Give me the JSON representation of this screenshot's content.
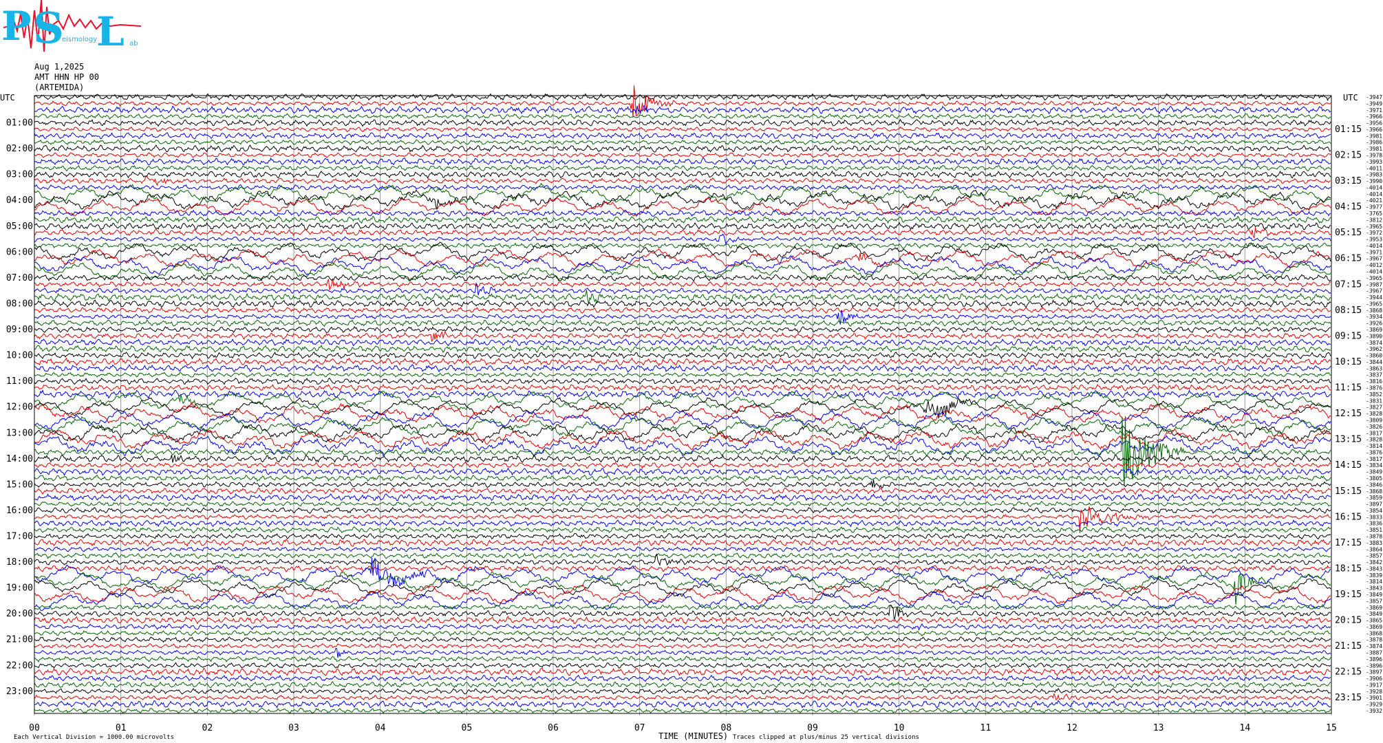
{
  "logo": {
    "letters": [
      "P",
      "S",
      "L"
    ],
    "sub_texts": [
      "eismology",
      "ab"
    ],
    "colors": {
      "letters": "#1ab3e6",
      "wave": "#e8102a"
    }
  },
  "header": {
    "date": "Aug 1,2025",
    "station": "AMT HHN HP 00",
    "name": "(ARTEMIDA)"
  },
  "footer": {
    "scale": "Each Vertical Division = 1000.00 microvolts",
    "xlabel": "TIME (MINUTES)",
    "clip_note": "Traces clipped at plus/minus 25 vertical divisions"
  },
  "chart_data": {
    "type": "line",
    "title": "",
    "xlabel": "TIME (MINUTES)",
    "ylabel": "UTC",
    "xlim": [
      0,
      15
    ],
    "x_ticks": [
      "00",
      "01",
      "02",
      "03",
      "04",
      "05",
      "06",
      "07",
      "08",
      "09",
      "10",
      "11",
      "12",
      "13",
      "14",
      "15"
    ],
    "left_axis_label": "UTC",
    "right_axis_label": "UTC",
    "left_ticks": [
      "01:00",
      "02:00",
      "03:00",
      "04:00",
      "05:00",
      "06:00",
      "07:00",
      "08:00",
      "09:00",
      "10:00",
      "11:00",
      "12:00",
      "13:00",
      "14:00",
      "15:00",
      "16:00",
      "17:00",
      "18:00",
      "19:00",
      "20:00",
      "21:00",
      "22:00",
      "23:00"
    ],
    "right_ticks": [
      "01:15",
      "02:15",
      "03:15",
      "04:15",
      "05:15",
      "06:15",
      "07:15",
      "08:15",
      "09:15",
      "10:15",
      "11:15",
      "12:15",
      "13:15",
      "14:15",
      "15:15",
      "16:15",
      "17:15",
      "18:15",
      "19:15",
      "20:15",
      "21:15",
      "22:15",
      "23:15"
    ],
    "trace_colors": [
      "#000000",
      "#e00000",
      "#0000e6",
      "#006400"
    ],
    "trace_count": 96,
    "trace_offsets": [
      "-3947",
      "-3949",
      "-3971",
      "-3966",
      "-3956",
      "-3966",
      "-3981",
      "-3986",
      "-3981",
      "-3978",
      "-3993",
      "-4011",
      "-3983",
      "-3990",
      "-4014",
      "-4014",
      "-4021",
      "-3977",
      "-3765",
      "-3812",
      "-3965",
      "-3972",
      "-3953",
      "-4014",
      "-3971",
      "-3967",
      "-4012",
      "-4014",
      "-3965",
      "-3987",
      "-3967",
      "-3944",
      "-3965",
      "-3868",
      "-3934",
      "-3926",
      "-3869",
      "-3890",
      "-3874",
      "-3962",
      "-3860",
      "-3844",
      "-3863",
      "-3837",
      "-3816",
      "-3876",
      "-3852",
      "-3831",
      "-3827",
      "-3828",
      "-3809",
      "-3826",
      "-3817",
      "-3828",
      "-3814",
      "-3876",
      "-3817",
      "-3834",
      "-3849",
      "-3805",
      "-3846",
      "-3868",
      "-3859",
      "-3897",
      "-3854",
      "-3833",
      "-3836",
      "-3851",
      "-3878",
      "-3883",
      "-3864",
      "-3857",
      "-3842",
      "-3843",
      "-3839",
      "-3814",
      "-3843",
      "-3849",
      "-3857",
      "-3869",
      "-3849",
      "-3865",
      "-3869",
      "-3868",
      "-3878",
      "-3874",
      "-3887",
      "-3896",
      "-3896",
      "-3897",
      "-3906",
      "-3917",
      "-3928",
      "-3901",
      "-3929",
      "-3932"
    ],
    "events": [
      {
        "trace": 1,
        "minute": 6.9,
        "amp": 4.0,
        "dur": 0.5
      },
      {
        "trace": 2,
        "minute": 6.95,
        "amp": 1.2,
        "dur": 0.3
      },
      {
        "trace": 13,
        "minute": 1.3,
        "amp": 0.8,
        "dur": 0.5
      },
      {
        "trace": 16,
        "minute": 4.6,
        "amp": 1.2,
        "dur": 0.5
      },
      {
        "trace": 22,
        "minute": 7.9,
        "amp": 1.2,
        "dur": 0.5
      },
      {
        "trace": 21,
        "minute": 14.1,
        "amp": 1.0,
        "dur": 0.4
      },
      {
        "trace": 25,
        "minute": 9.5,
        "amp": 1.0,
        "dur": 0.5
      },
      {
        "trace": 29,
        "minute": 3.4,
        "amp": 1.2,
        "dur": 0.5
      },
      {
        "trace": 30,
        "minute": 5.1,
        "amp": 1.3,
        "dur": 0.4
      },
      {
        "trace": 31,
        "minute": 6.4,
        "amp": 0.9,
        "dur": 0.4
      },
      {
        "trace": 34,
        "minute": 9.3,
        "amp": 1.3,
        "dur": 0.5
      },
      {
        "trace": 37,
        "minute": 4.6,
        "amp": 1.0,
        "dur": 0.5
      },
      {
        "trace": 47,
        "minute": 1.7,
        "amp": 0.8,
        "dur": 0.5
      },
      {
        "trace": 48,
        "minute": 10.3,
        "amp": 2.0,
        "dur": 0.8
      },
      {
        "trace": 55,
        "minute": 12.6,
        "amp": 6.0,
        "dur": 0.8
      },
      {
        "trace": 56,
        "minute": 1.6,
        "amp": 1.0,
        "dur": 0.2
      },
      {
        "trace": 60,
        "minute": 9.7,
        "amp": 0.8,
        "dur": 0.3
      },
      {
        "trace": 65,
        "minute": 12.1,
        "amp": 2.5,
        "dur": 0.8
      },
      {
        "trace": 72,
        "minute": 7.2,
        "amp": 1.0,
        "dur": 0.6
      },
      {
        "trace": 74,
        "minute": 3.9,
        "amp": 1.8,
        "dur": 1.3
      },
      {
        "trace": 75,
        "minute": 13.9,
        "amp": 2.5,
        "dur": 0.4
      },
      {
        "trace": 80,
        "minute": 9.9,
        "amp": 1.8,
        "dur": 0.3
      },
      {
        "trace": 82,
        "minute": 10.2,
        "amp": 1.0,
        "dur": 0.2
      },
      {
        "trace": 86,
        "minute": 3.5,
        "amp": 1.0,
        "dur": 0.2
      },
      {
        "trace": 93,
        "minute": 11.8,
        "amp": 0.9,
        "dur": 0.5
      }
    ],
    "long_period_rows": [
      [
        15,
        17
      ],
      [
        24,
        27
      ],
      [
        47,
        54
      ],
      [
        74,
        78
      ]
    ]
  }
}
